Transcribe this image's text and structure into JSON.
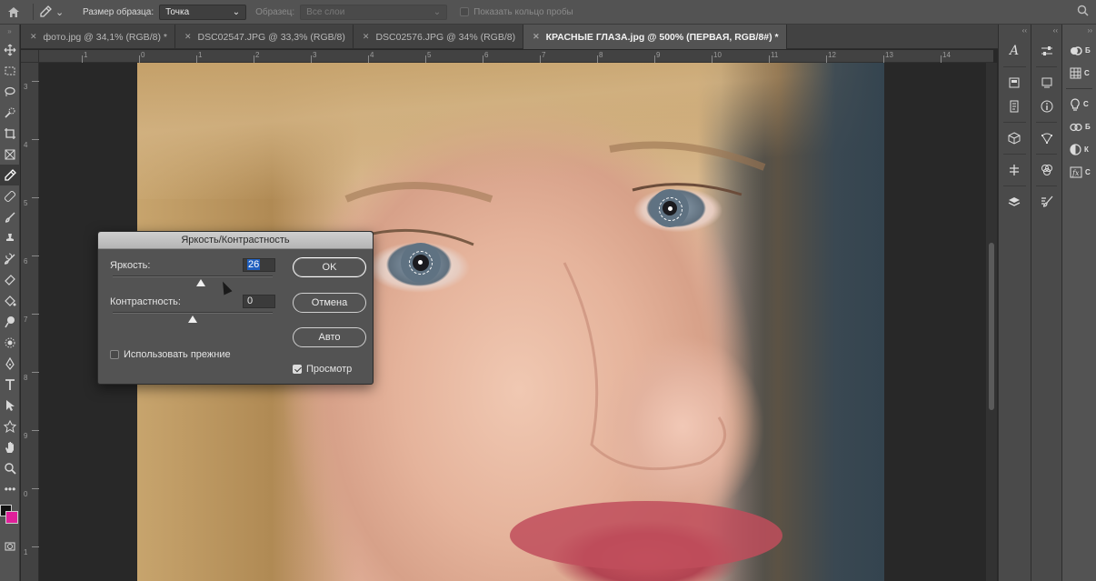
{
  "options_bar": {
    "sample_size_label": "Размер образца:",
    "sample_size_value": "Точка",
    "sample_label": "Образец:",
    "sample_value": "Все слои",
    "show_ring_label": "Показать кольцо пробы"
  },
  "tabs": [
    {
      "label": "фото.jpg @ 34,1% (RGB/8) *",
      "active": false
    },
    {
      "label": "DSC02547.JPG @ 33,3% (RGB/8)",
      "active": false
    },
    {
      "label": "DSC02576.JPG @ 34% (RGB/8)",
      "active": false
    },
    {
      "label": "КРАСНЫЕ ГЛАЗА.jpg @ 500% (ПЕРВАЯ, RGB/8#) *",
      "active": true
    }
  ],
  "ruler_h_labels": [
    "1",
    "0",
    "1",
    "2",
    "3",
    "4",
    "5",
    "6",
    "7",
    "8",
    "9",
    "10",
    "11",
    "12",
    "13",
    "14"
  ],
  "ruler_v_labels": [
    "3",
    "4",
    "5",
    "6",
    "7",
    "8",
    "9",
    "0",
    "1"
  ],
  "dialog": {
    "title": "Яркость/Контрастность",
    "brightness_label": "Яркость:",
    "brightness_value": "26",
    "brightness_level": 0.55,
    "contrast_label": "Контрастность:",
    "contrast_value": "0",
    "contrast_level": 0.5,
    "ok_label": "OK",
    "cancel_label": "Отмена",
    "auto_label": "Авто",
    "legacy_label": "Использовать прежние",
    "legacy_checked": false,
    "preview_label": "Просмотр",
    "preview_checked": true
  },
  "right_panel": {
    "items": [
      {
        "icon": "lightbulb-icon",
        "text": "Б"
      },
      {
        "icon": "grid-icon",
        "text": "С"
      },
      {
        "icon": "bulb-icon",
        "text": "С"
      },
      {
        "icon": "cc-libraries-icon",
        "text": "Б"
      },
      {
        "icon": "adjustments-icon",
        "text": "К"
      },
      {
        "icon": "styles-icon",
        "text": "С"
      }
    ]
  },
  "colors": {
    "foreground": "#111111",
    "background": "#e0209a",
    "accent_selection": "#1f5fbf"
  }
}
